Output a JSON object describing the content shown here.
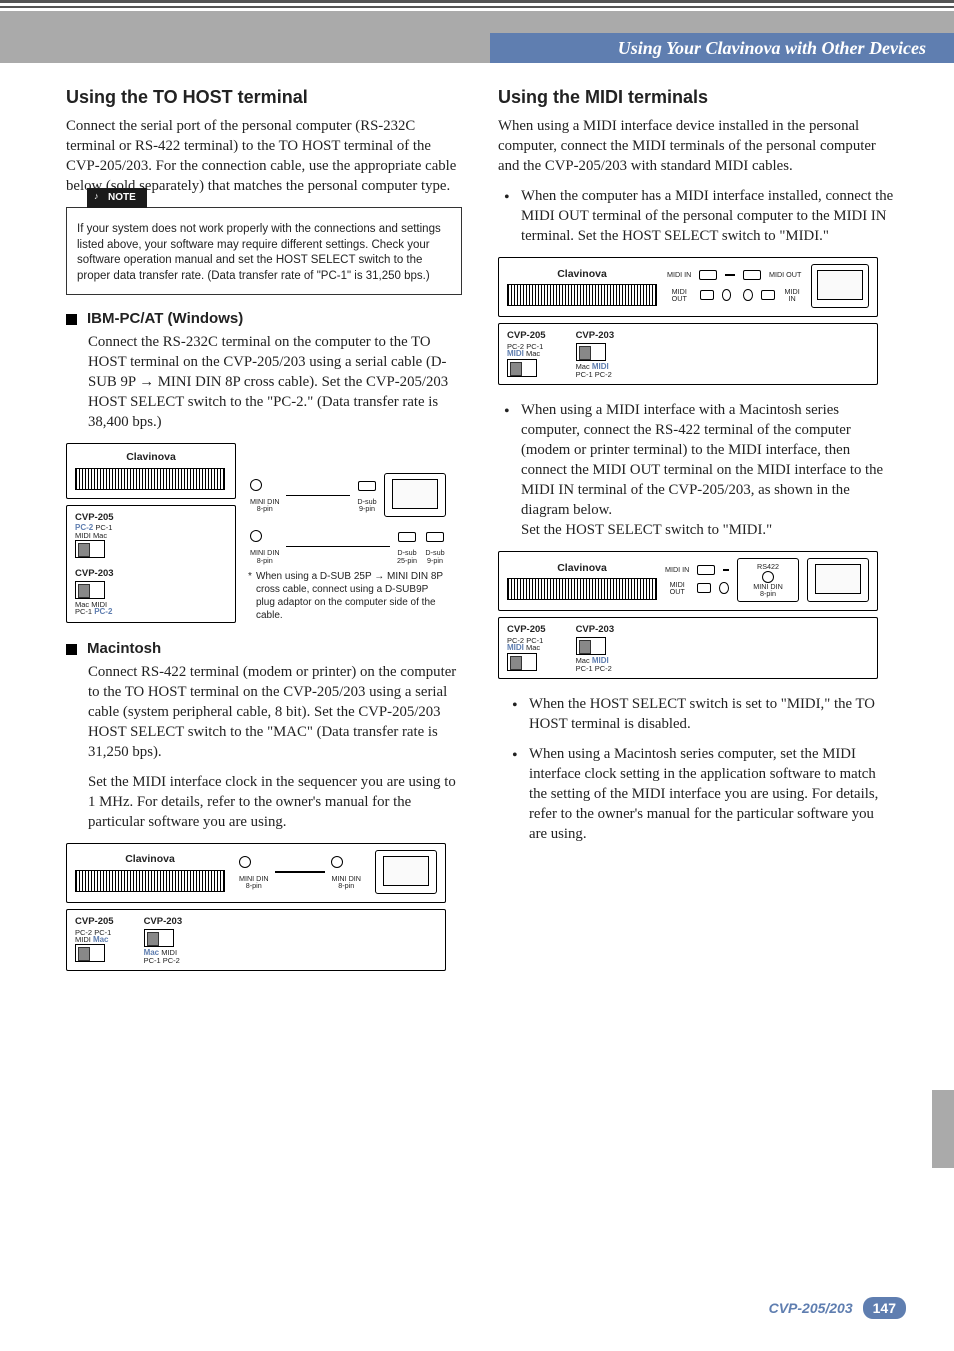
{
  "header": {
    "breadcrumb": "Using Your Clavinova with Other Devices"
  },
  "footer": {
    "model": "CVP-205/203",
    "page_number": "147"
  },
  "left": {
    "title": "Using the TO HOST terminal",
    "intro": "Connect the serial port of the personal computer (RS-232C terminal or RS-422 terminal) to the TO HOST terminal of the CVP-205/203. For the connection cable, use the appropriate cable below (sold separately) that matches the personal computer type.",
    "note_label": "NOTE",
    "note_body": "If your system does not work properly with the connections and settings listed above, your software may require different settings. Check your software operation manual and set the HOST SELECT switch to the proper data transfer rate. (Data transfer rate of \"PC-1\" is 31,250 bps.)",
    "ibm": {
      "title": "IBM-PC/AT (Windows)",
      "body": "Connect the RS-232C terminal on the computer to the TO HOST terminal on the CVP-205/203 using a serial cable (D-SUB 9P → MINI DIN 8P cross cable). Set the CVP-205/203 HOST SELECT switch to the \"PC-2.\" (Data transfer rate is 38,400 bps.)",
      "diagram": {
        "clavinova": "Clavinova",
        "mini_din_8pin": "MINI DIN\n8-pin",
        "dsub_9pin": "D-sub\n9-pin",
        "cvp205": "CVP-205",
        "cvp203": "CVP-203",
        "switch_labels": {
          "MIDI": "MIDI",
          "PC2": "PC-2",
          "PC1": "PC-1",
          "Mac": "Mac"
        },
        "dsub_25pin": "D-sub\n25-pin",
        "note_star": "*",
        "note": "When using a D-SUB 25P → MINI DIN 8P cross cable, connect using a D-SUB9P plug adaptor on the computer side of the cable."
      }
    },
    "mac": {
      "title": "Macintosh",
      "body1": "Connect RS-422 terminal (modem or printer) on the computer to the TO HOST terminal on the CVP-205/203 using a serial cable (system peripheral cable, 8 bit). Set the CVP-205/203 HOST SELECT switch to the \"MAC\" (Data transfer rate is 31,250 bps).",
      "body2": "Set the MIDI interface clock in the sequencer you are using to 1 MHz. For details, refer to the owner's manual for the particular software you are using.",
      "diagram": {
        "clavinova": "Clavinova",
        "mini_din_8pin": "MINI DIN\n8-pin",
        "cvp205": "CVP-205",
        "cvp203": "CVP-203",
        "switch_labels": {
          "MIDI": "MIDI",
          "PC2": "PC-2",
          "PC1": "PC-1",
          "Mac": "Mac"
        }
      }
    }
  },
  "right": {
    "title": "Using the MIDI terminals",
    "intro": "When using a MIDI interface device installed in the personal computer, connect the MIDI terminals of the personal computer and the CVP-205/203 with standard MIDI cables.",
    "bullet1": "When the computer has a MIDI interface installed, connect the MIDI OUT terminal of the personal computer to the MIDI IN terminal. Set the HOST SELECT switch to \"MIDI.\"",
    "diagram1": {
      "clavinova": "Clavinova",
      "midi_in": "MIDI IN",
      "midi_out": "MIDI OUT",
      "cvp205": "CVP-205",
      "cvp203": "CVP-203",
      "switch_labels": {
        "MIDI": "MIDI",
        "PC2": "PC-2",
        "PC1": "PC-1",
        "Mac": "Mac"
      }
    },
    "bullet2": "When using a MIDI interface with a Macintosh series computer, connect the RS-422 terminal of the computer (modem or printer terminal) to the MIDI interface, then connect the MIDI OUT terminal on the MIDI interface to the MIDI IN terminal of the CVP-205/203, as shown in the diagram below.\nSet the HOST SELECT switch to \"MIDI.\"",
    "diagram2": {
      "clavinova": "Clavinova",
      "midi_in": "MIDI IN",
      "midi_out": "MIDI OUT",
      "rs422": "RS422",
      "mini_din_8pin": "MINI DIN\n8-pin",
      "cvp205": "CVP-205",
      "cvp203": "CVP-203",
      "switch_labels": {
        "MIDI": "MIDI",
        "PC2": "PC-2",
        "PC1": "PC-1",
        "Mac": "Mac"
      }
    },
    "note1": "When the HOST SELECT switch is set to \"MIDI,\" the TO HOST terminal is disabled.",
    "note2": "When using a Macintosh series computer, set the MIDI interface clock setting in the application software to match the setting of the MIDI interface you are using. For details, refer to the owner's manual for the particular software you are using."
  }
}
